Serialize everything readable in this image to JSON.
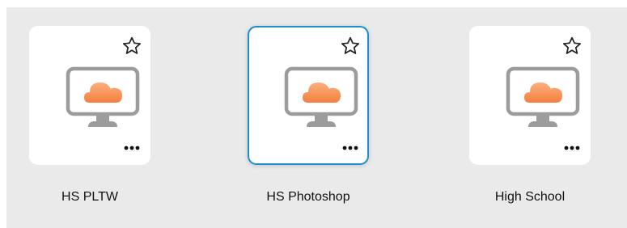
{
  "apps": [
    {
      "name": "HS PLTW",
      "icon": "cloud-monitor-icon",
      "selected": false
    },
    {
      "name": "HS Photoshop",
      "icon": "cloud-monitor-icon",
      "selected": true
    },
    {
      "name": "High School",
      "icon": "cloud-monitor-icon",
      "selected": false
    }
  ],
  "colors": {
    "background": "#eaeaea",
    "card": "#ffffff",
    "selected_border": "#1b8fd1",
    "cloud": "#f6935a",
    "monitor": "#9a9a9a"
  }
}
